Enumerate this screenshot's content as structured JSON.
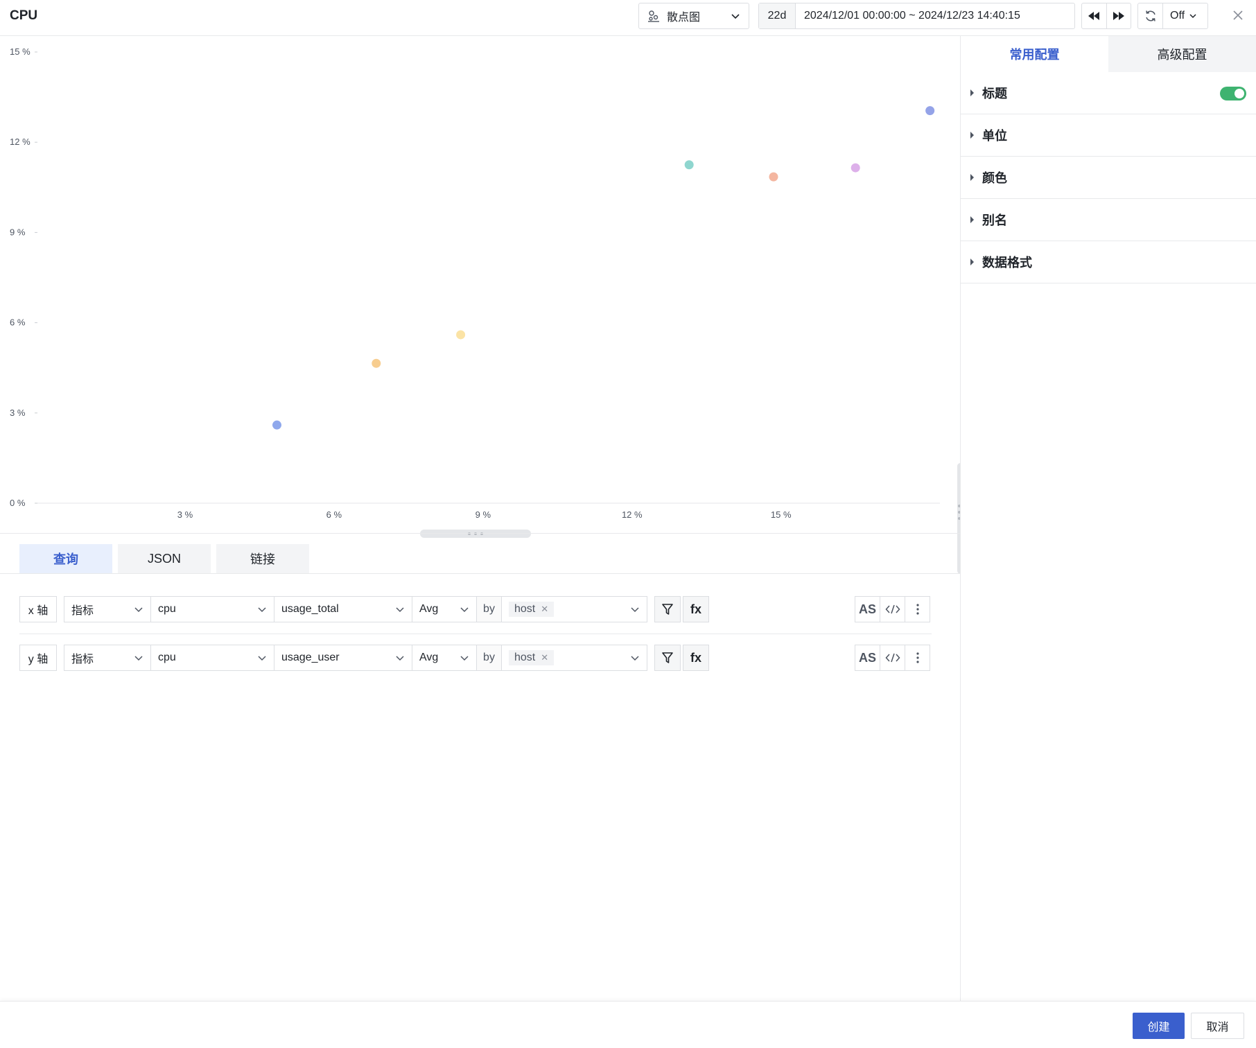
{
  "header": {
    "title": "CPU",
    "chart_type": "散点图",
    "time_span": "22d",
    "time_range": "2024/12/01 00:00:00 ~ 2024/12/23 14:40:15",
    "refresh": "Off"
  },
  "query_tabs": [
    "查询",
    "JSON",
    "链接"
  ],
  "query_rows": [
    {
      "axis": "x 轴",
      "source": "指标",
      "measurement": "cpu",
      "field": "usage_total",
      "agg": "Avg",
      "by": "by",
      "tag": "host"
    },
    {
      "axis": "y 轴",
      "source": "指标",
      "measurement": "cpu",
      "field": "usage_user",
      "agg": "Avg",
      "by": "by",
      "tag": "host"
    }
  ],
  "row_buttons": {
    "fx": "fx",
    "as": "AS"
  },
  "panel": {
    "tabs": [
      "常用配置",
      "高级配置"
    ],
    "sections": [
      "标题",
      "单位",
      "颜色",
      "别名",
      "数据格式"
    ]
  },
  "footer": {
    "create": "创建",
    "cancel": "取消"
  },
  "chart_data": {
    "type": "scatter",
    "x_ticks": [
      "3 %",
      "6 %",
      "9 %",
      "12 %",
      "15 %"
    ],
    "y_ticks": [
      "0 %",
      "3 %",
      "6 %",
      "9 %",
      "12 %",
      "15 %"
    ],
    "xlim": [
      0,
      18.2
    ],
    "ylim": [
      0,
      15
    ],
    "grid": false,
    "points": [
      {
        "x": 4.85,
        "y": 2.6,
        "color": "#8fa8ec"
      },
      {
        "x": 6.85,
        "y": 4.65,
        "color": "#f7cd8f"
      },
      {
        "x": 8.55,
        "y": 5.6,
        "color": "#fbe3a5"
      },
      {
        "x": 13.15,
        "y": 11.25,
        "color": "#8fd6cf"
      },
      {
        "x": 14.85,
        "y": 10.85,
        "color": "#f4b6a0"
      },
      {
        "x": 16.5,
        "y": 11.15,
        "color": "#ddb0ea"
      },
      {
        "x": 18.0,
        "y": 13.05,
        "color": "#94a3e8"
      }
    ]
  }
}
